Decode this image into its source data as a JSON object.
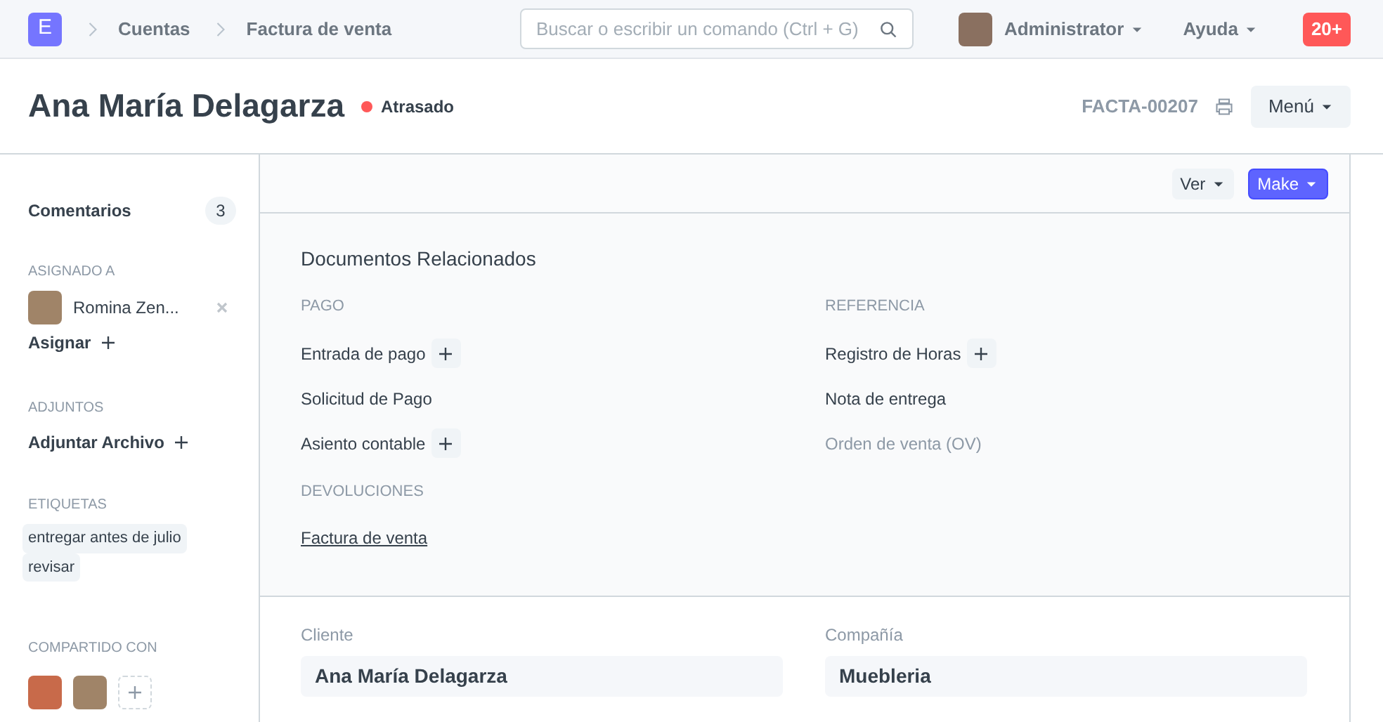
{
  "navbar": {
    "logo": "E",
    "breadcrumbs": [
      "Cuentas",
      "Factura de venta"
    ],
    "search": {
      "placeholder": "Buscar o escribir un comando (Ctrl + G)"
    },
    "user": "Administrator",
    "help": "Ayuda",
    "notifications": "20+"
  },
  "header": {
    "title": "Ana María Delagarza",
    "status": {
      "label": "Atrasado",
      "color": "#ff5858"
    },
    "doc_id": "FACTA-00207",
    "menu_button": "Menú"
  },
  "sidebar": {
    "comments": {
      "label": "Comentarios",
      "count": "3"
    },
    "assigned": {
      "heading": "ASIGNADO A",
      "users": [
        "Romina Zen..."
      ],
      "action": "Asignar"
    },
    "attachments": {
      "heading": "ADJUNTOS",
      "action": "Adjuntar Archivo"
    },
    "tags": {
      "heading": "ETIQUETAS",
      "items": [
        "entregar antes de julio",
        "revisar"
      ]
    },
    "shared": {
      "heading": "COMPARTIDO CON"
    }
  },
  "toolbar": {
    "buttons": [
      {
        "label": "Ver",
        "kind": "default"
      },
      {
        "label": "Make",
        "kind": "primary"
      }
    ]
  },
  "related": {
    "title": "Documentos Relacionados",
    "groups": [
      {
        "heading": "PAGO",
        "items": [
          {
            "label": "Entrada de pago",
            "kind": "normal",
            "addable": true
          },
          {
            "label": "Solicitud de Pago",
            "kind": "normal",
            "addable": false
          },
          {
            "label": "Asiento contable",
            "kind": "normal",
            "addable": true
          }
        ]
      },
      {
        "heading": "REFERENCIA",
        "items": [
          {
            "label": "Registro de Horas",
            "kind": "normal",
            "addable": true
          },
          {
            "label": "Nota de entrega",
            "kind": "normal",
            "addable": false
          },
          {
            "label": "Orden de venta (OV)",
            "kind": "muted",
            "addable": false
          }
        ]
      },
      {
        "heading": "DEVOLUCIONES",
        "items": [
          {
            "label": "Factura de venta",
            "kind": "underlined",
            "addable": false
          }
        ]
      }
    ]
  },
  "form": {
    "fields": [
      {
        "label": "Cliente",
        "value": "Ana María Delagarza"
      },
      {
        "label": "Compañía",
        "value": "Muebleria"
      }
    ]
  }
}
